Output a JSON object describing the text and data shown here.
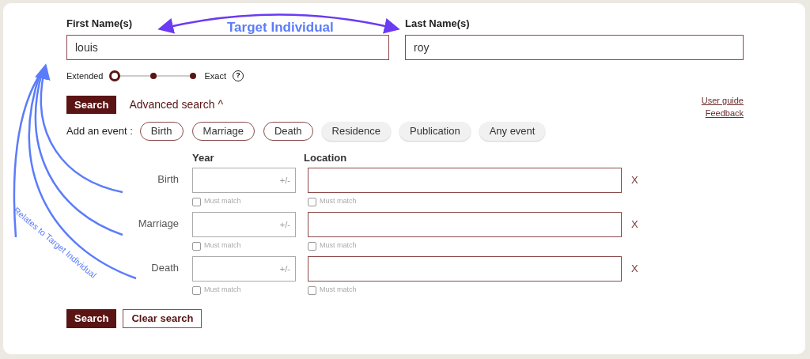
{
  "annotations": {
    "title": "Target Individual",
    "side_note": "Relates to Target Individual"
  },
  "name_fields": [
    {
      "label": "First Name(s)",
      "value": "louis"
    },
    {
      "label": "Last Name(s)",
      "value": "roy"
    }
  ],
  "match_slider": {
    "start_label": "Extended",
    "end_label": "Exact",
    "level": 0,
    "help": "?"
  },
  "search_button": "Search",
  "advanced_link": "Advanced search ^",
  "help_links": [
    "User guide",
    "Feedback"
  ],
  "add_event": {
    "label": "Add an event :",
    "chips": [
      {
        "label": "Birth",
        "selected": true
      },
      {
        "label": "Marriage",
        "selected": true
      },
      {
        "label": "Death",
        "selected": true
      },
      {
        "label": "Residence",
        "selected": false
      },
      {
        "label": "Publication",
        "selected": false
      },
      {
        "label": "Any event",
        "selected": false
      }
    ]
  },
  "event_table": {
    "columns": [
      "Year",
      "Location"
    ],
    "rows": [
      {
        "label": "Birth",
        "year_suffix": "+/-",
        "year_must_match": {
          "label": "Must match",
          "checked": false
        },
        "location_must_match": {
          "label": "Must match",
          "checked": false
        },
        "remove": "X"
      },
      {
        "label": "Marriage",
        "year_suffix": "+/-",
        "year_must_match": {
          "label": "Must match",
          "checked": false
        },
        "location_must_match": {
          "label": "Must match",
          "checked": false
        },
        "remove": "X"
      },
      {
        "label": "Death",
        "year_suffix": "+/-",
        "year_must_match": {
          "label": "Must match",
          "checked": false
        },
        "location_must_match": {
          "label": "Must match",
          "checked": false
        },
        "remove": "X"
      }
    ]
  },
  "actions": [
    {
      "label": "Search",
      "kind": "primary"
    },
    {
      "label": "Clear search",
      "kind": "secondary"
    }
  ]
}
